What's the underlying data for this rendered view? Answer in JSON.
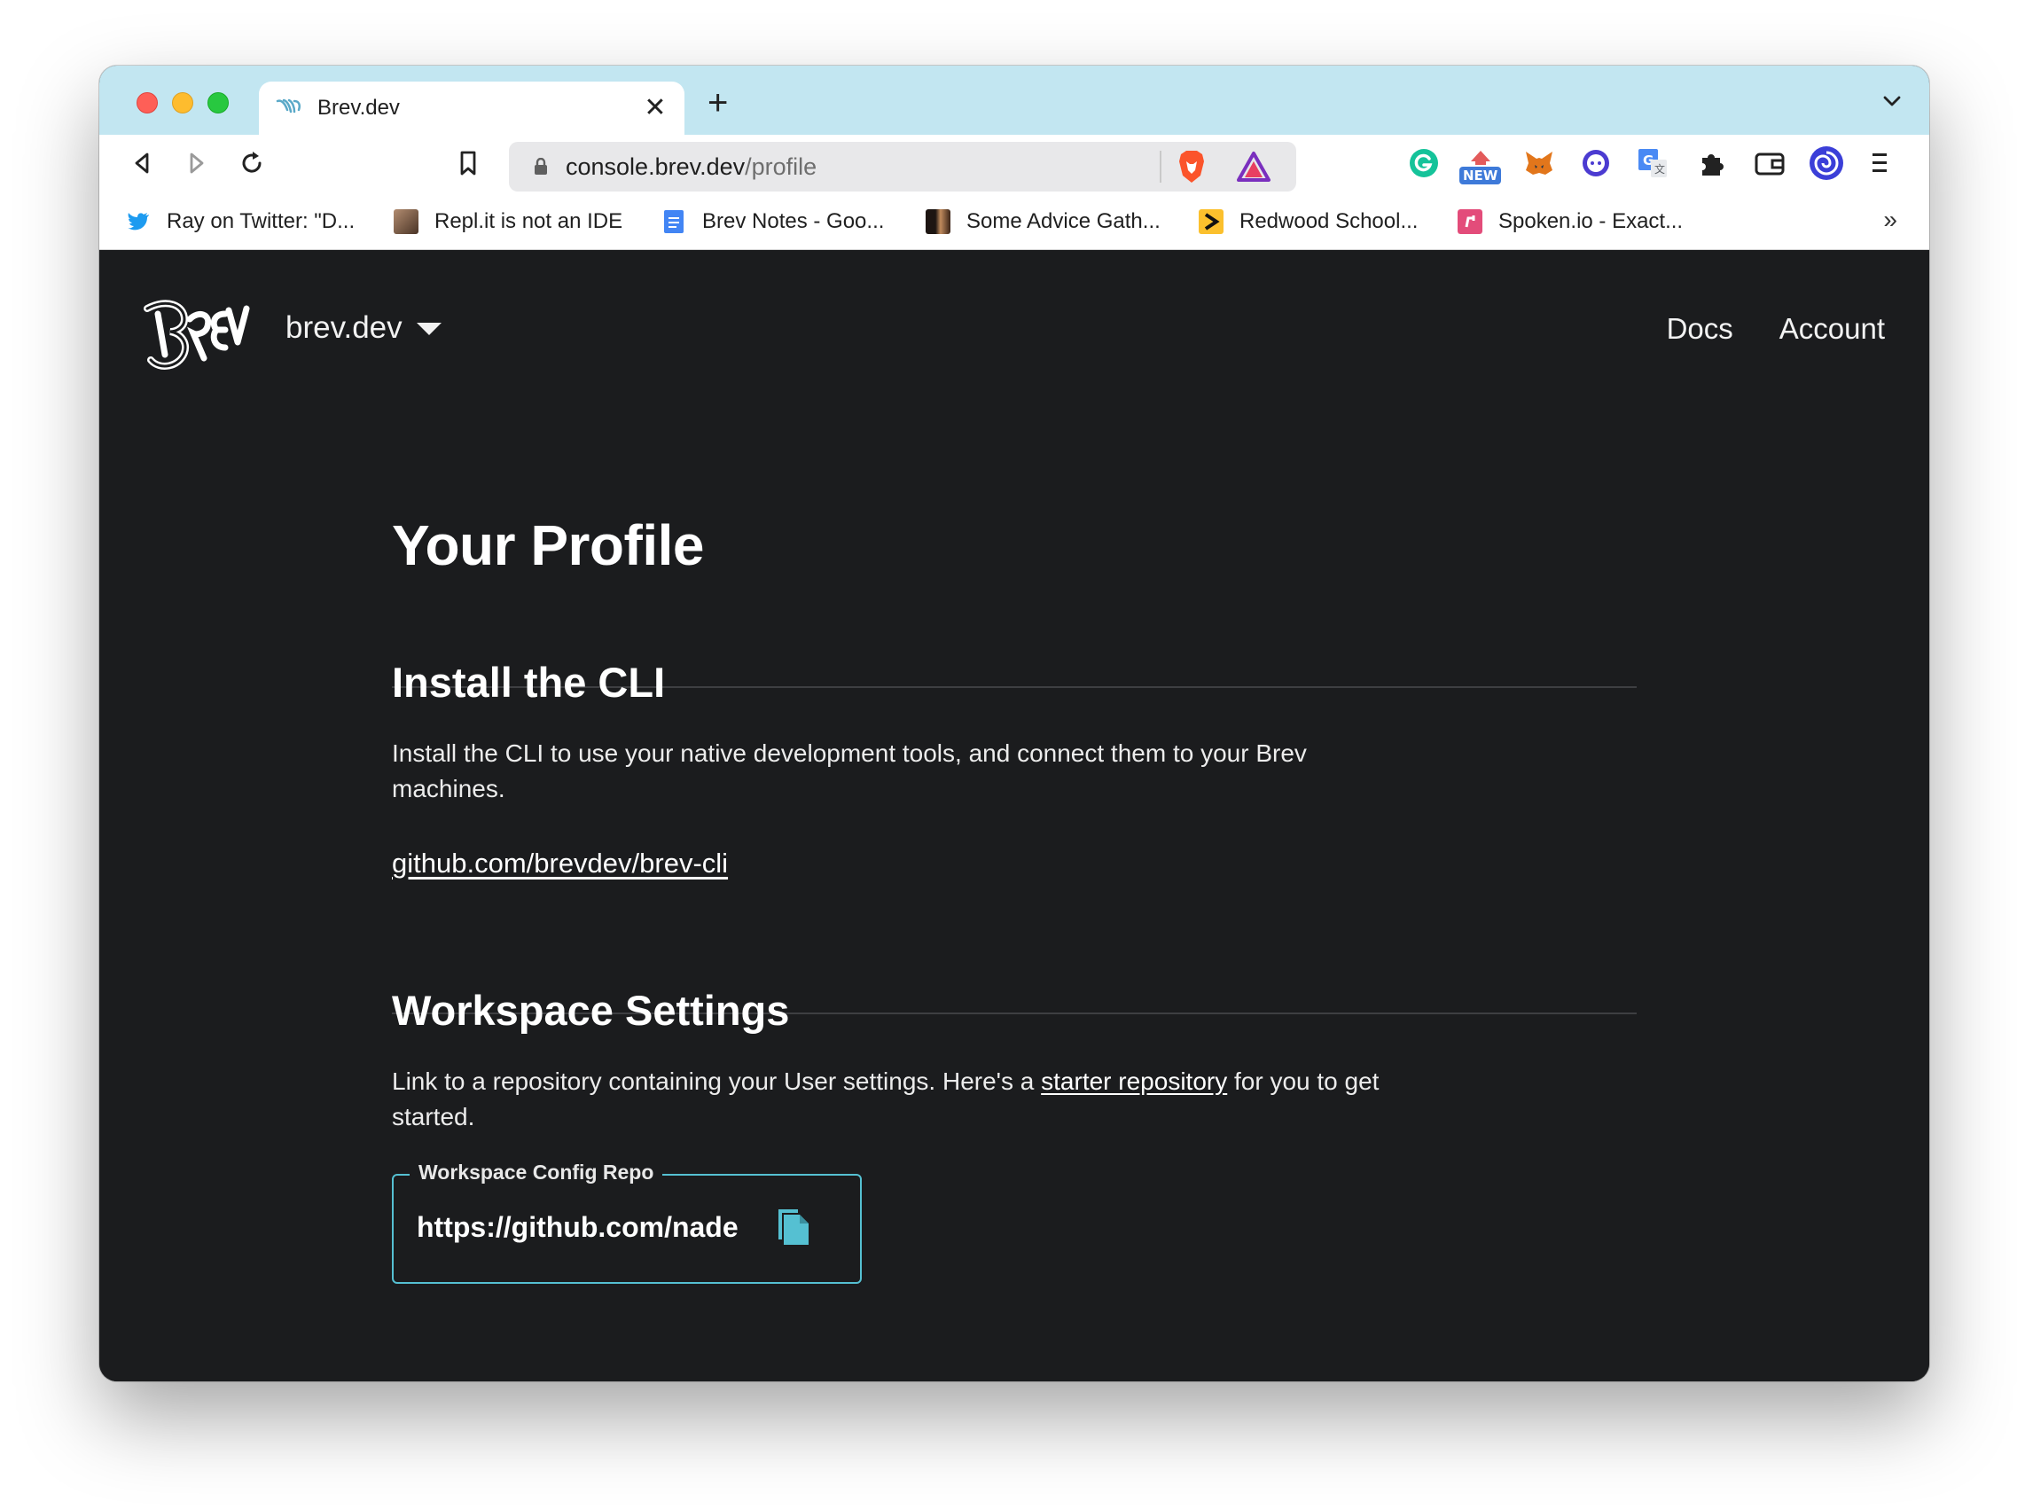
{
  "browser": {
    "tab_title": "Brev.dev",
    "new_tab_symbol": "+",
    "close_symbol": "✕",
    "url_host": "console.brev.dev",
    "url_path": "/profile",
    "extensions": [
      "grammarly-icon",
      "new-badge-extension-icon",
      "metamask-icon",
      "chat-extension-icon",
      "translate-icon",
      "extensions-puzzle-icon",
      "wallet-icon",
      "profile-swirl-icon",
      "menu-icon"
    ],
    "new_badge": "NEW",
    "bookmarks": [
      {
        "label": "Ray on Twitter: \"D...",
        "icon": "twitter-icon",
        "color": "#1d9bf0"
      },
      {
        "label": "Repl.it is not an IDE",
        "icon": "photo-icon",
        "color": "#7a5a48"
      },
      {
        "label": "Brev Notes - Goo...",
        "icon": "google-docs-icon",
        "color": "#4285f4"
      },
      {
        "label": "Some Advice Gath...",
        "icon": "photo-icon",
        "color": "#5b3b2b"
      },
      {
        "label": "Redwood School...",
        "icon": "redwood-icon",
        "color": "#fbc02d"
      },
      {
        "label": "Spoken.io - Exact...",
        "icon": "spoken-icon",
        "color": "#e34c7a"
      }
    ],
    "bookmarks_more": "»"
  },
  "header": {
    "org_name": "brev.dev",
    "nav": {
      "docs": "Docs",
      "account": "Account"
    }
  },
  "main": {
    "title": "Your Profile",
    "cli": {
      "heading": "Install the CLI",
      "description": "Install the CLI to use your native development tools, and connect them to your Brev machines.",
      "link": "github.com/brevdev/brev-cli"
    },
    "workspace": {
      "heading": "Workspace Settings",
      "desc_before": "Link to a repository containing your User settings. Here's a ",
      "desc_link": "starter repository",
      "desc_after": " for you to get started.",
      "field_label": "Workspace Config Repo",
      "field_value": "https://github.com/nade"
    }
  },
  "colors": {
    "page_bg": "#1b1c1e",
    "accent": "#55c0d2",
    "tab_strip": "#c2e6f1"
  }
}
